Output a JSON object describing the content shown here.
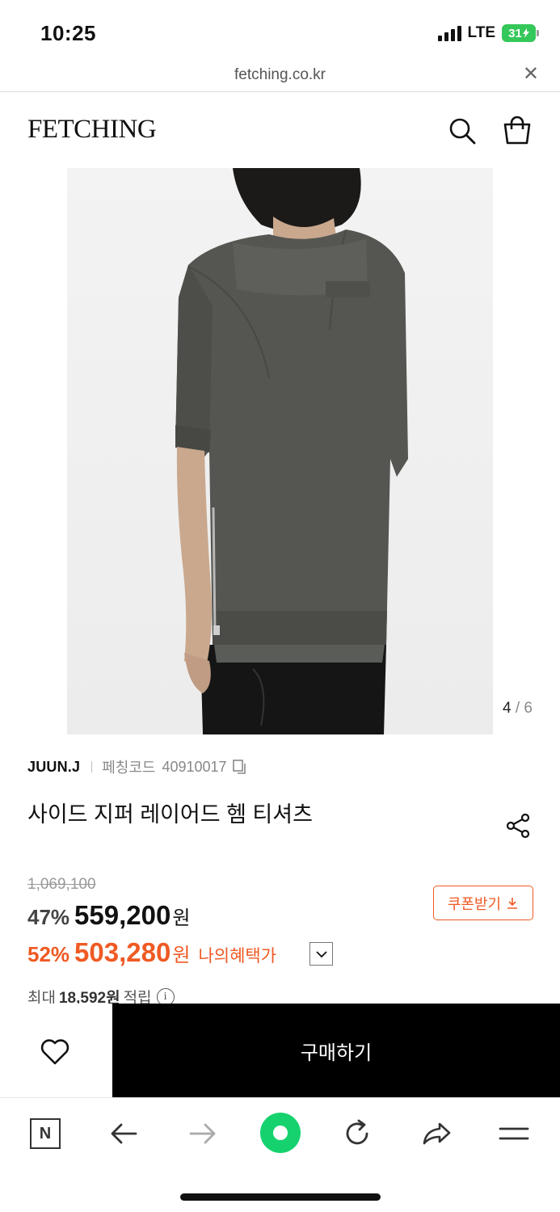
{
  "status": {
    "time": "10:25",
    "network": "LTE",
    "battery": "31"
  },
  "browser": {
    "url": "fetching.co.kr",
    "close_icon": "close-icon"
  },
  "header": {
    "logo": "FETCHING",
    "icons": [
      "search-icon",
      "shopping-bag-icon"
    ]
  },
  "gallery": {
    "current": "4",
    "total": "6",
    "divider": "/"
  },
  "product": {
    "brand": "JUUN.J",
    "code_label": "페칭코드",
    "code": "40910017",
    "title": "사이드 지퍼 레이어드 헴 티셔츠",
    "original_price": "1,069,100",
    "discount": "47%",
    "price": "559,200",
    "currency": "원",
    "member_discount": "52%",
    "member_price": "503,280",
    "member_label": "나의혜택가",
    "coupon_label": "쿠폰받기",
    "points_prefix": "최대",
    "points_amount": "18,592원",
    "points_suffix": "적립"
  },
  "actions": {
    "buy_label": "구매하기"
  },
  "colors": {
    "accent": "#ef5a24",
    "buy_bg": "#000000",
    "battery": "#34c759"
  },
  "toolbar": {
    "icons": [
      "naver-icon",
      "back-arrow-icon",
      "forward-arrow-icon",
      "green-dot-icon",
      "refresh-icon",
      "share-icon",
      "menu-icon"
    ],
    "naver_letter": "N"
  }
}
